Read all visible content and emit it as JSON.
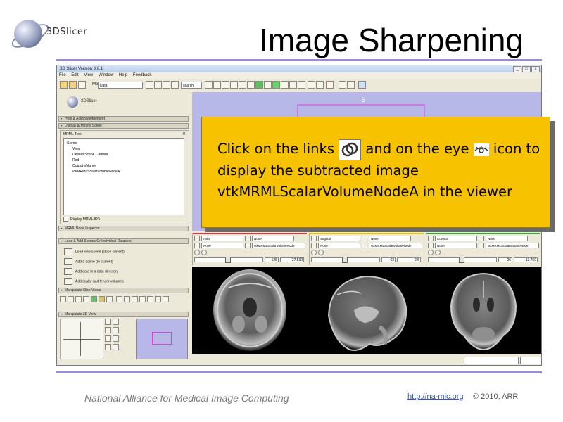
{
  "slide": {
    "logo_text": "3DSlicer",
    "title": "Image Sharpening",
    "footer_org": "National Alliance for Medical Image Computing",
    "footer_link": "http://na-mic.org",
    "footer_copyright": "© 2010, ARR"
  },
  "window": {
    "title": "3D Slicer Version 3.6.1",
    "controls": [
      "_",
      "□",
      "x"
    ],
    "menu": [
      "File",
      "Edit",
      "View",
      "Window",
      "Help",
      "Feedback"
    ],
    "toolbar": {
      "modules_label": "Modules:",
      "module_value": "Data",
      "search_value": "search"
    }
  },
  "left_panel": {
    "logo_text": "3DSlicer",
    "sections": [
      "Help & Acknowledgement",
      "Display & Modify Scene",
      "MRML Node Inspector",
      "Load & Add Scenes Or Individual Datasets",
      "Manipulate Slice Views",
      "Manipulate 3D View"
    ],
    "tree_header": "MRML Tree",
    "tree_items": [
      "Scene",
      "View",
      "Default Scene Camera",
      "Red",
      "Output Volume",
      "vtkMRMLScalarVolumeNodeA"
    ],
    "display_ids_label": "Display MRML ID's",
    "load_rows": [
      "Load new scene (close current)",
      "Add a scene (to current)",
      "Add data in a data directory",
      "Add scalar and tensor volumes"
    ]
  },
  "view3d": {
    "orientation_label": "S"
  },
  "slice_views": [
    {
      "name": "Axial",
      "color": "#d83a3a",
      "combo1": "Axial",
      "combo2": "None",
      "combo3": "None",
      "combo4": "vtkMRMLScalarVolumeNode",
      "offset_value": "125",
      "coord_value": "-27.532"
    },
    {
      "name": "Sagittal",
      "color": "#e6c800",
      "combo1": "Sagittal",
      "combo2": "None",
      "combo3": "None",
      "combo4": "vtkMRMLScalarVolumeNode",
      "offset_value": "63",
      "coord_value": "2.5"
    },
    {
      "name": "Coronal",
      "color": "#38a838",
      "combo1": "Coronal",
      "combo2": "None",
      "combo3": "None",
      "combo4": "vtkMRMLScalarVolumeNode",
      "offset_value": "26",
      "coord_value": "13.769"
    }
  ],
  "callout": {
    "text_part1": "Click on the links",
    "text_part2": "and on the eye",
    "text_part3": "icon to display  the subtracted image vtkMRMLScalarVolumeNodeA in the viewer",
    "link_icon": "link-icon",
    "eye_icon": "eye-icon",
    "background_color": "#f7c300"
  }
}
